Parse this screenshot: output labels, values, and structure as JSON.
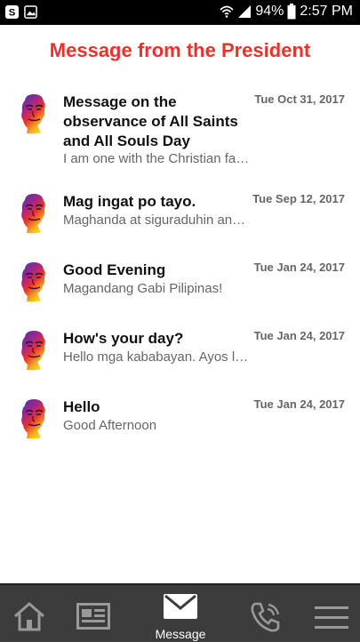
{
  "status_bar": {
    "battery": "94%",
    "time": "2:57 PM"
  },
  "page": {
    "title": "Message from the President"
  },
  "messages": [
    {
      "title": "Message on the observance of All Saints and All Souls Day",
      "date": "Tue Oct 31, 2017",
      "snippet": "I am one with the Christian faithful"
    },
    {
      "title": "Mag ingat po tayo.",
      "date": "Tue Sep 12, 2017",
      "snippet": "Maghanda at siguraduhin ang inyong kaligtasan"
    },
    {
      "title": "Good Evening",
      "date": "Tue Jan 24, 2017",
      "snippet": "Magandang Gabi Pilipinas!"
    },
    {
      "title": "How's your day?",
      "date": "Tue Jan 24, 2017",
      "snippet": "Hello mga kababayan. Ayos lang ba kayo?"
    },
    {
      "title": "Hello",
      "date": "Tue Jan 24, 2017",
      "snippet": "Good Afternoon"
    }
  ],
  "bottom_nav": {
    "message_label": "Message"
  },
  "colors": {
    "title": "#e8322b",
    "nav_bg": "#3c3c3c"
  }
}
